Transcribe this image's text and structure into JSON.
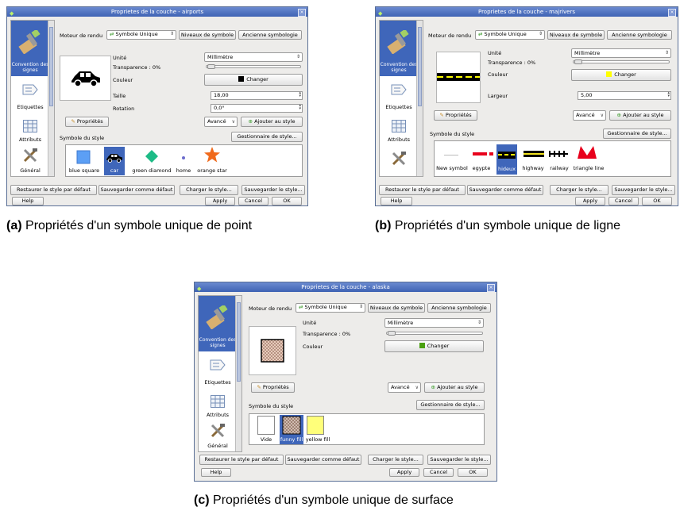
{
  "panel_a": {
    "title": "Proprietes de la couche - airports",
    "sidebar": {
      "selected": "Convention des signes",
      "items": [
        "Etiquettes",
        "Attributs",
        "Général"
      ]
    },
    "moteur_label": "Moteur de rendu",
    "moteur_value": "Symbole Unique",
    "niveaux": "Niveaux de symbole",
    "ancienne": "Ancienne symbologie",
    "unite_label": "Unité",
    "unite_value": "Millimètre",
    "transparence": "Transparence : 0%",
    "couleur_label": "Couleur",
    "changer": "Changer",
    "taille_label": "Taille",
    "taille_value": "18,00",
    "rotation_label": "Rotation",
    "rotation_value": "0,0°",
    "proprietes": "Propriétés",
    "avance": "Avancé",
    "ajouter": "Ajouter au style",
    "symbole_du_style": "Symbole du style",
    "gestionnaire": "Gestionnaire de style...",
    "symbols": [
      "blue square",
      "car",
      "green diamond",
      "home",
      "orange star"
    ],
    "selected_symbol": "car",
    "restaurer": "Restaurer le style par défaut",
    "sauvegarder_defaut": "Sauvegarder comme défaut",
    "charger": "Charger le style...",
    "sauvegarder": "Sauvegarder le style...",
    "help": "Help",
    "apply": "Apply",
    "cancel": "Cancel",
    "ok": "OK",
    "caption_label": "(a)",
    "caption_text": "Propriétés d'un symbole unique de point",
    "swatch_color": "#000000"
  },
  "panel_b": {
    "title": "Proprietes de la couche - majrivers",
    "sidebar": {
      "selected": "Convention des signes",
      "items": [
        "Etiquettes",
        "Attributs"
      ]
    },
    "moteur_label": "Moteur de rendu",
    "moteur_value": "Symbole Unique",
    "niveaux": "Niveaux de symbole",
    "ancienne": "Ancienne symbologie",
    "unite_label": "Unité",
    "unite_value": "Millimètre",
    "transparence": "Transparence : 0%",
    "couleur_label": "Couleur",
    "changer": "Changer",
    "largeur_label": "Largeur",
    "largeur_value": "5,00",
    "proprietes": "Propriétés",
    "avance": "Avancé",
    "ajouter": "Ajouter au style",
    "symbole_du_style": "Symbole du style",
    "gestionnaire": "Gestionnaire de style...",
    "symbols": [
      "New symbol",
      "egypte",
      "hideux",
      "highway",
      "railway",
      "triangle line"
    ],
    "selected_symbol": "hideux",
    "restaurer": "Restaurer le style par défaut",
    "sauvegarder_defaut": "Sauvegarder comme défaut",
    "charger": "Charger le style...",
    "sauvegarder": "Sauvegarder le style...",
    "help": "Help",
    "apply": "Apply",
    "cancel": "Cancel",
    "ok": "OK",
    "caption_label": "(b)",
    "caption_text": "Propriétés d'un symbole unique de ligne",
    "swatch_color": "#ffff00"
  },
  "panel_c": {
    "title": "Proprietes de la couche - alaska",
    "sidebar": {
      "selected": "Convention des signes",
      "items": [
        "Etiquettes",
        "Attributs",
        "Général"
      ]
    },
    "moteur_label": "Moteur de rendu",
    "moteur_value": "Symbole Unique",
    "niveaux": "Niveaux de symbole",
    "ancienne": "Ancienne symbologie",
    "unite_label": "Unité",
    "unite_value": "Millimètre",
    "transparence": "Transparence : 0%",
    "couleur_label": "Couleur",
    "changer": "Changer",
    "proprietes": "Propriétés",
    "avance": "Avancé",
    "ajouter": "Ajouter au style",
    "symbole_du_style": "Symbole du style",
    "gestionnaire": "Gestionnaire de style...",
    "symbols": [
      "Vide",
      "funny fill",
      "yellow fill"
    ],
    "selected_symbol": "funny fill",
    "restaurer": "Restaurer le style par défaut",
    "sauvegarder_defaut": "Sauvegarder comme défaut",
    "charger": "Charger le style...",
    "sauvegarder": "Sauvegarder le style...",
    "help": "Help",
    "apply": "Apply",
    "cancel": "Cancel",
    "ok": "OK",
    "caption_label": "(c)",
    "caption_text": "Propriétés d'un symbole unique de surface",
    "swatch_color": "#4aa010"
  }
}
